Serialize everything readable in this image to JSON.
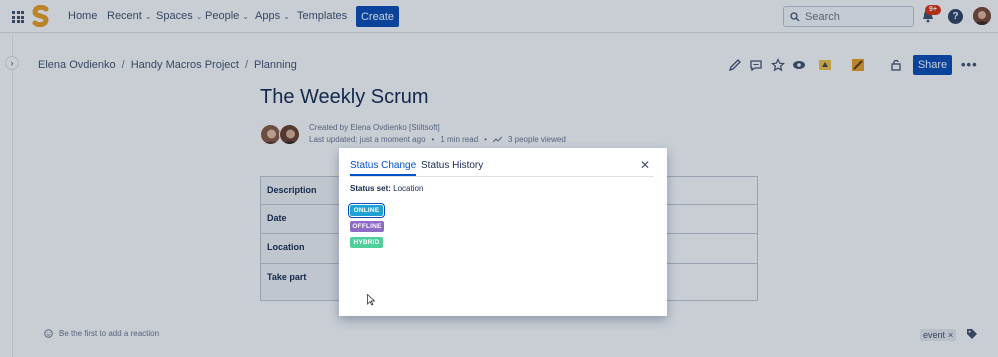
{
  "topnav": {
    "items": [
      {
        "label": "Home",
        "has_dropdown": false
      },
      {
        "label": "Recent",
        "has_dropdown": true
      },
      {
        "label": "Spaces",
        "has_dropdown": true
      },
      {
        "label": "People",
        "has_dropdown": true
      },
      {
        "label": "Apps",
        "has_dropdown": true
      },
      {
        "label": "Templates",
        "has_dropdown": false
      }
    ],
    "create_label": "Create",
    "search_placeholder": "Search",
    "notification_badge": "9+",
    "help_label": "?",
    "colors": {
      "primary": "#0b4db5",
      "logo": "#f0a020",
      "badge": "#de350b"
    }
  },
  "breadcrumb": [
    "Elena Ovdienko",
    "Handy Macros Project",
    "Planning"
  ],
  "toolbar": {
    "icons": [
      "edit-icon",
      "comment-icon",
      "star-icon",
      "watch-icon",
      "macro-app-icon",
      "app-icon",
      "restrictions-icon"
    ],
    "share_label": "Share",
    "more_label": "•••"
  },
  "page": {
    "title": "The Weekly Scrum",
    "created_by": "Created by Elena Ovdienko [Stiltsoft]",
    "last_updated": "Last updated: just a moment ago",
    "read_time": "1 min read",
    "viewers": "3 people viewed",
    "table_rows": [
      "Description",
      "Date",
      "Location",
      "Take part"
    ]
  },
  "footer": {
    "reaction_text": "Be the first to add a reaction",
    "label": "event",
    "label_remove": "×"
  },
  "dialog": {
    "tabs": [
      "Status Change",
      "Status History"
    ],
    "active_tab": 0,
    "close_label": "✕",
    "status_set_label": "Status set:",
    "status_set_value": "Location",
    "statuses": [
      {
        "label": "ONLINE",
        "color": "#1ea2d6",
        "selected": true
      },
      {
        "label": "OFFLINE",
        "color": "#8e6bc4",
        "selected": false
      },
      {
        "label": "HYBRID",
        "color": "#4fcf9a",
        "selected": false
      }
    ]
  }
}
